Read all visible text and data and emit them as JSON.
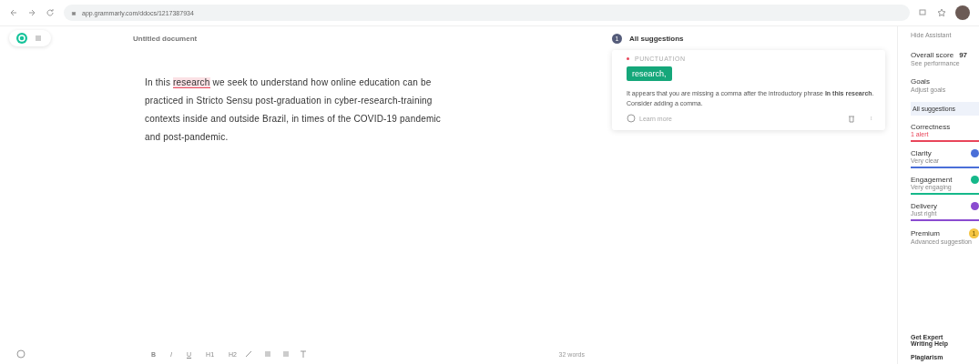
{
  "browser": {
    "url": "app.grammarly.com/ddocs/1217387934"
  },
  "document": {
    "title": "Untitled document",
    "segments": [
      {
        "text": "In this ",
        "flagged": false
      },
      {
        "text": "research",
        "flagged": true
      },
      {
        "text": " we seek to understand how online education can be practiced in Stricto Sensu post-graduation in cyber-research-training contexts inside and outside Brazil, in times of the COVID-19 pandemic and post-pandemic.",
        "flagged": false
      }
    ]
  },
  "toolbar": {
    "buttons": [
      "B",
      "I",
      "U",
      "H1",
      "H2"
    ],
    "word_count": "32 words"
  },
  "suggestions": {
    "count": "1",
    "title": "All suggestions",
    "card": {
      "category": "PUNCTUATION",
      "replacement": "research,",
      "message": "It appears that you are missing a comma after the introductory phrase **In this research**. Consider adding a comma.",
      "learn_more": "Learn more"
    }
  },
  "assistant": {
    "hide": "Hide Assistant",
    "score_label": "Overall score",
    "score": "97",
    "performance": "See performance",
    "goals": "Goals",
    "goals_link": "Adjust goals",
    "all": "All suggestions",
    "categories": [
      {
        "name": "Correctness",
        "status": "1 alert",
        "color": "#e8455a",
        "kind": "alert"
      },
      {
        "name": "Clarity",
        "status": "Very clear",
        "color": "#4a6fd8",
        "kind": "check"
      },
      {
        "name": "Engagement",
        "status": "Very engaging",
        "color": "#15b88a",
        "kind": "check"
      },
      {
        "name": "Delivery",
        "status": "Just right",
        "color": "#8a4bd0",
        "kind": "check"
      },
      {
        "name": "Premium",
        "status": "Advanced suggestion",
        "color": "#f5c542",
        "kind": "premium",
        "badge": "1"
      }
    ],
    "expert": "Get Expert Writing Help",
    "plagiarism": "Plagiarism"
  }
}
